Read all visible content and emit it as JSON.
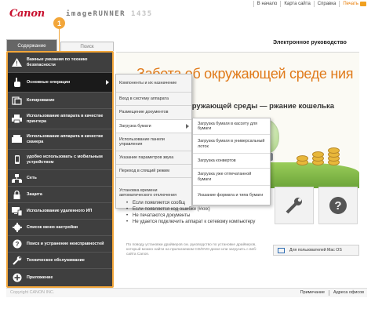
{
  "header": {
    "brand": "Canon",
    "product_name": "imageRUNNER",
    "model": "1435",
    "links": [
      "В начало",
      "Карта сайта",
      "Справка",
      "Печать"
    ]
  },
  "badge": "1",
  "tabs": {
    "contents": "Содержание",
    "search": "Поиск"
  },
  "main_title": "Электронное руководство",
  "sidebar": {
    "items": [
      {
        "label": "Важные указания по технике безопасности",
        "icon": "warning-icon"
      },
      {
        "label": "Основные операции",
        "icon": "hand-pointer-icon",
        "active": true
      },
      {
        "label": "Копирование",
        "icon": "copy-icon"
      },
      {
        "label": "Использование аппарата в качестве принтера",
        "icon": "printer-icon"
      },
      {
        "label": "Использование аппарата в качестве сканера",
        "icon": "scanner-icon"
      },
      {
        "label": "удобно использовать с мобильным устройством",
        "icon": "mobile-icon"
      },
      {
        "label": "Сеть",
        "icon": "network-icon"
      },
      {
        "label": "Защита",
        "icon": "lock-icon"
      },
      {
        "label": "Использование удаленного ИП",
        "icon": "remote-ui-icon"
      },
      {
        "label": "Список меню настройки",
        "icon": "gear-icon"
      },
      {
        "label": "Поиск и устранение неисправностей",
        "icon": "question-icon"
      },
      {
        "label": "Техническое обслуживание",
        "icon": "wrench-icon"
      },
      {
        "label": "Приложение",
        "icon": "plus-icon"
      }
    ]
  },
  "submenu": {
    "items": [
      {
        "label": "Компоненты и их назначение"
      },
      {
        "label": "Вход в систему аппарата"
      },
      {
        "label": "Размещение документов"
      },
      {
        "label": "Загрузка бумаги",
        "active": true
      },
      {
        "label": "Использование панели управления"
      },
      {
        "label": "Указание параметров звука"
      },
      {
        "label": "Переход в спящий режим"
      },
      {
        "label": "Установка времени автоматического отключения"
      }
    ]
  },
  "flyout": {
    "items": [
      {
        "label": "Загрузка бумаги в кассету для бумаги"
      },
      {
        "label": "Загрузка бумаги в универсальный лоток"
      },
      {
        "label": "Загрузка конвертов"
      },
      {
        "label": "Загрузка уже отпечатанной бумаги"
      },
      {
        "label": "Указание формата и типа бумаги"
      }
    ]
  },
  "hero": {
    "title": "Забота об окружающей среде ния средств",
    "subtitle": "кружающей среды — ржание кошелька"
  },
  "bullets": [
    "Если появляется сообщ",
    "Если появляется код ошибки (#xxx)",
    "Не печатаются документы",
    "Не удается подключить аппарат к сетевому компьютеру"
  ],
  "note": "По поводу установки драйверов см. руководство по установке драйверов, который можно найти на прилагаемом CD/DVD-диске или загрузить с веб-сайта Canon.",
  "mac_button": "Для пользователей Mac OS",
  "footer": {
    "copyright": "Copyright CANON INC.",
    "links": [
      "Примечание",
      "Адреса офисов"
    ]
  },
  "colors": {
    "accent": "#f2a63a",
    "brand_red": "#c8102e",
    "sidebar_bg": "#3f3f3f",
    "hero_orange": "#e07a1a"
  }
}
